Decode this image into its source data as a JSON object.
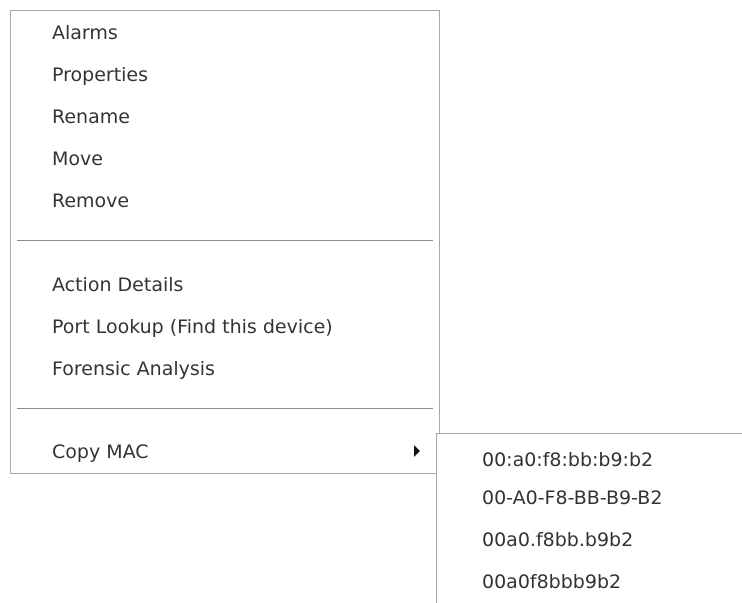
{
  "context_menu": {
    "group1": [
      "Alarms",
      "Properties",
      "Rename",
      "Move",
      "Remove"
    ],
    "group2": [
      "Action Details",
      "Port Lookup (Find this device)",
      "Forensic Analysis"
    ],
    "copy_mac_label": "Copy MAC"
  },
  "copy_mac_submenu": {
    "items": [
      "00:a0:f8:bb:b9:b2",
      "00-A0-F8-BB-B9-B2",
      "00a0.f8bb.b9b2",
      "00a0f8bbb9b2"
    ]
  }
}
